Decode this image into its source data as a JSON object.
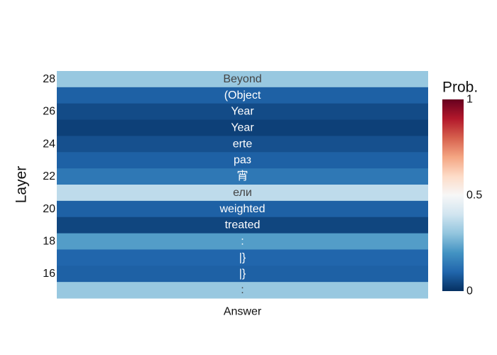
{
  "chart_data": {
    "type": "heatmap",
    "x_categories": [
      "Answer"
    ],
    "y_label": "Layer",
    "y_ticks": [
      28,
      26,
      24,
      22,
      20,
      18,
      16
    ],
    "rows": [
      {
        "layer": 28,
        "token": "Beyond",
        "prob": 0.31
      },
      {
        "layer": 27,
        "token": "(Object",
        "prob": 0.09
      },
      {
        "layer": 26,
        "token": "Year",
        "prob": 0.05
      },
      {
        "layer": 25,
        "token": "Year",
        "prob": 0.03
      },
      {
        "layer": 24,
        "token": "erte",
        "prob": 0.06
      },
      {
        "layer": 23,
        "token": "раз",
        "prob": 0.09
      },
      {
        "layer": 22,
        "token": "宵",
        "prob": 0.14
      },
      {
        "layer": 21,
        "token": "ели",
        "prob": 0.37
      },
      {
        "layer": 20,
        "token": "weighted",
        "prob": 0.09
      },
      {
        "layer": 19,
        "token": "treated",
        "prob": 0.04
      },
      {
        "layer": 18,
        "token": ":",
        "prob": 0.22
      },
      {
        "layer": 17,
        "token": "|}",
        "prob": 0.1
      },
      {
        "layer": 16,
        "token": "|}",
        "prob": 0.09
      },
      {
        "layer": 15,
        "token": ":",
        "prob": 0.31
      }
    ],
    "colorbar": {
      "title": "Prob.",
      "ticks": [
        "1",
        "0.5",
        "0"
      ],
      "range": [
        0,
        1
      ],
      "colorscale": [
        "#053061",
        "#2166ac",
        "#4393c3",
        "#92c5de",
        "#d1e5f0",
        "#f7f7f7",
        "#fddbc7",
        "#f4a582",
        "#d6604d",
        "#b2182b",
        "#67001f"
      ]
    }
  }
}
